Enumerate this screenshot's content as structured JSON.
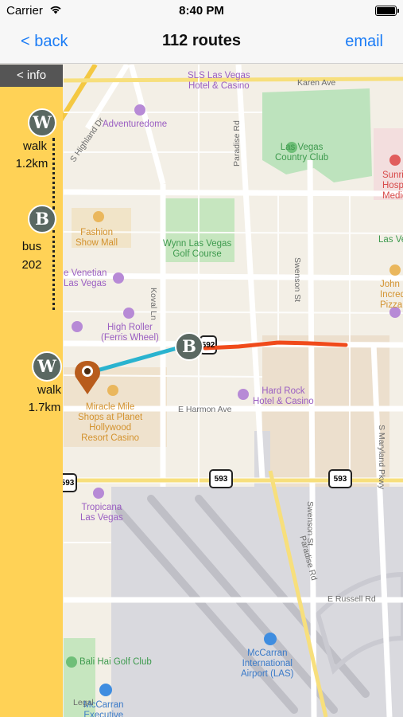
{
  "status_bar": {
    "carrier": "Carrier",
    "time": "8:40 PM"
  },
  "nav": {
    "back_label": "< back",
    "title": "112 routes",
    "email_label": "email"
  },
  "panel": {
    "info_label": "< info",
    "steps": [
      {
        "icon_letter": "W",
        "mode": "walk",
        "detail": "1.2km"
      },
      {
        "icon_letter": "B",
        "mode": "bus",
        "detail": "202"
      },
      {
        "icon_letter": "W",
        "mode": "walk",
        "detail": "1.7km"
      }
    ]
  },
  "map": {
    "route_markers": {
      "bus_stop_letter": "B",
      "walk_letter": "W"
    },
    "route_colors": {
      "walk": "#2ab3cf",
      "bus": "#f04a1a",
      "pin": "#b85c1c"
    },
    "labels": {
      "sls": "SLS Las Vegas\nHotel & Casino",
      "karen": "Karen Ave",
      "adventuredome": "Adventuredome",
      "highland": "S Highland Dr",
      "paradise_top": "Paradise Rd",
      "lvcc": "Las Vegas\nCountry Club",
      "sunrise": "Sunri\nHospita\nMedical C",
      "fashion": "Fashion\nShow Mall",
      "wynn": "Wynn Las Vegas\nGolf Course",
      "swenson_top": "Swenson St",
      "lv_right": "Las Ve",
      "venetian": "e Venetian\nLas Vegas",
      "koval": "Koval Ln",
      "john": "John\nIncredi\nPizza C",
      "highroller": "High Roller\n(Ferris Wheel)",
      "hardrock": "Hard Rock\nHotel & Casino",
      "miracle": "Miracle Mile\nShops at Planet\nHollywood\nResort Casino",
      "harmon": "E Harmon Ave",
      "maryland": "S Maryland Pkwy",
      "shield_593_a": "593",
      "shield_593_b": "593",
      "shield_593_c": "593",
      "shield_592": "592",
      "tropicana": "Tropicana\nLas Vegas",
      "swenson_bottom": "Swenson St",
      "paradise_bottom": "Paradise Rd",
      "russell": "E Russell Rd",
      "mccarran": "McCarran\nInternational\nAirport (LAS)",
      "balihai": "Bali Hai Golf Club",
      "mccarran_exec": "McCarran\nExecutive",
      "legal": "Legal"
    }
  }
}
